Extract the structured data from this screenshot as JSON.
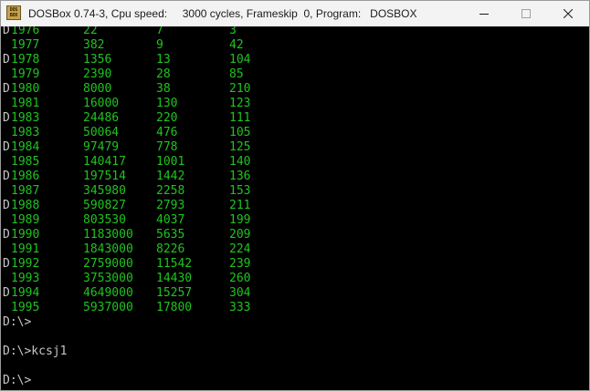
{
  "window": {
    "title": "DOSBox 0.74-3, Cpu speed:     3000 cycles, Frameskip  0, Program:   DOSBOX",
    "icon_label": "DOS BOX"
  },
  "colors": {
    "data_text": "#1fc41f",
    "prompt_text": "#c7c7c7",
    "background": "#000000"
  },
  "rows": [
    {
      "prefix": "D",
      "year": "1976",
      "b": "22",
      "c": "7",
      "d": "3"
    },
    {
      "prefix": "",
      "year": "1977",
      "b": "382",
      "c": "9",
      "d": "42"
    },
    {
      "prefix": "D",
      "year": "1978",
      "b": "1356",
      "c": "13",
      "d": "104"
    },
    {
      "prefix": "",
      "year": "1979",
      "b": "2390",
      "c": "28",
      "d": "85"
    },
    {
      "prefix": "D",
      "year": "1980",
      "b": "8000",
      "c": "38",
      "d": "210"
    },
    {
      "prefix": "",
      "year": "1981",
      "b": "16000",
      "c": "130",
      "d": "123"
    },
    {
      "prefix": "D",
      "year": "1983",
      "b": "24486",
      "c": "220",
      "d": "111"
    },
    {
      "prefix": "",
      "year": "1983",
      "b": "50064",
      "c": "476",
      "d": "105"
    },
    {
      "prefix": "D",
      "year": "1984",
      "b": "97479",
      "c": "778",
      "d": "125"
    },
    {
      "prefix": "",
      "year": "1985",
      "b": "140417",
      "c": "1001",
      "d": "140"
    },
    {
      "prefix": "D",
      "year": "1986",
      "b": "197514",
      "c": "1442",
      "d": "136"
    },
    {
      "prefix": "",
      "year": "1987",
      "b": "345980",
      "c": "2258",
      "d": "153"
    },
    {
      "prefix": "D",
      "year": "1988",
      "b": "590827",
      "c": "2793",
      "d": "211"
    },
    {
      "prefix": "",
      "year": "1989",
      "b": "803530",
      "c": "4037",
      "d": "199"
    },
    {
      "prefix": "D",
      "year": "1990",
      "b": "1183000",
      "c": "5635",
      "d": "209"
    },
    {
      "prefix": "",
      "year": "1991",
      "b": "1843000",
      "c": "8226",
      "d": "224"
    },
    {
      "prefix": "D",
      "year": "1992",
      "b": "2759000",
      "c": "11542",
      "d": "239"
    },
    {
      "prefix": "",
      "year": "1993",
      "b": "3753000",
      "c": "14430",
      "d": "260"
    },
    {
      "prefix": "D",
      "year": "1994",
      "b": "4649000",
      "c": "15257",
      "d": "304"
    },
    {
      "prefix": "",
      "year": "1995",
      "b": "5937000",
      "c": "17800",
      "d": "333"
    }
  ],
  "prompts": {
    "after_table": "D:\\>",
    "command": "D:\\>kcsj1",
    "current": "D:\\>"
  }
}
